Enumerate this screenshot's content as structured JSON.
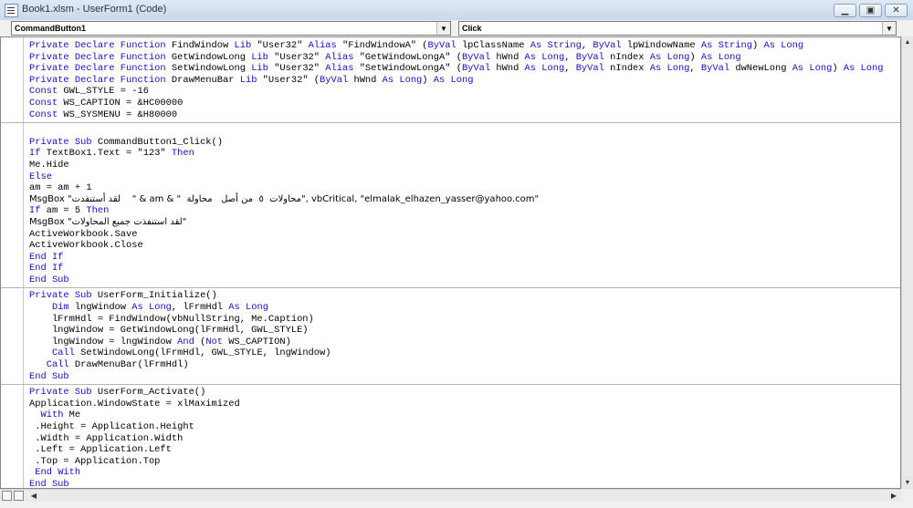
{
  "window": {
    "title": "Book1.xlsm - UserForm1 (Code)",
    "minimize_glyph": "▁",
    "maximize_glyph": "▣",
    "close_glyph": "✕"
  },
  "object_combo": {
    "value": "CommandButton1",
    "arrow": "▼"
  },
  "procedure_combo": {
    "value": "Click",
    "arrow": "▼"
  },
  "scroll": {
    "up": "▲",
    "down": "▼",
    "left": "◀",
    "right": "▶"
  },
  "code": {
    "declarations": [
      [
        {
          "t": "Private Declare Function ",
          "k": true
        },
        {
          "t": "FindWindow "
        },
        {
          "t": "Lib ",
          "k": true
        },
        {
          "t": "\"User32\" "
        },
        {
          "t": "Alias ",
          "k": true
        },
        {
          "t": "\"FindWindowA\" ("
        },
        {
          "t": "ByVal ",
          "k": true
        },
        {
          "t": "lpClassName "
        },
        {
          "t": "As String",
          "k": true
        },
        {
          "t": ", "
        },
        {
          "t": "ByVal ",
          "k": true
        },
        {
          "t": "lpWindowName "
        },
        {
          "t": "As String",
          "k": true
        },
        {
          "t": ") "
        },
        {
          "t": "As Long",
          "k": true
        }
      ],
      [
        {
          "t": "Private Declare Function ",
          "k": true
        },
        {
          "t": "GetWindowLong "
        },
        {
          "t": "Lib ",
          "k": true
        },
        {
          "t": "\"User32\" "
        },
        {
          "t": "Alias ",
          "k": true
        },
        {
          "t": "\"GetWindowLongA\" ("
        },
        {
          "t": "ByVal ",
          "k": true
        },
        {
          "t": "hWnd "
        },
        {
          "t": "As Long",
          "k": true
        },
        {
          "t": ", "
        },
        {
          "t": "ByVal ",
          "k": true
        },
        {
          "t": "nIndex "
        },
        {
          "t": "As Long",
          "k": true
        },
        {
          "t": ") "
        },
        {
          "t": "As Long",
          "k": true
        }
      ],
      [
        {
          "t": "Private Declare Function ",
          "k": true
        },
        {
          "t": "SetWindowLong "
        },
        {
          "t": "Lib ",
          "k": true
        },
        {
          "t": "\"User32\" "
        },
        {
          "t": "Alias ",
          "k": true
        },
        {
          "t": "\"SetWindowLongA\" ("
        },
        {
          "t": "ByVal ",
          "k": true
        },
        {
          "t": "hWnd "
        },
        {
          "t": "As Long",
          "k": true
        },
        {
          "t": ", "
        },
        {
          "t": "ByVal ",
          "k": true
        },
        {
          "t": "nIndex "
        },
        {
          "t": "As Long",
          "k": true
        },
        {
          "t": ", "
        },
        {
          "t": "ByVal ",
          "k": true
        },
        {
          "t": "dwNewLong "
        },
        {
          "t": "As Long",
          "k": true
        },
        {
          "t": ") "
        },
        {
          "t": "As Long",
          "k": true
        }
      ],
      [
        {
          "t": "Private Declare Function ",
          "k": true
        },
        {
          "t": "DrawMenuBar "
        },
        {
          "t": "Lib ",
          "k": true
        },
        {
          "t": "\"User32\" ("
        },
        {
          "t": "ByVal ",
          "k": true
        },
        {
          "t": "hWnd "
        },
        {
          "t": "As Long",
          "k": true
        },
        {
          "t": ") "
        },
        {
          "t": "As Long",
          "k": true
        }
      ],
      [
        {
          "t": "Const ",
          "k": true
        },
        {
          "t": "GWL_STYLE = -16"
        }
      ],
      [
        {
          "t": "Const ",
          "k": true
        },
        {
          "t": "WS_CAPTION = &HC00000"
        }
      ],
      [
        {
          "t": "Const ",
          "k": true
        },
        {
          "t": "WS_SYSMENU = &H80000"
        }
      ]
    ],
    "click_proc": [
      [
        {
          "t": ""
        }
      ],
      [
        {
          "t": "Private Sub ",
          "k": true
        },
        {
          "t": "CommandButton1_Click()"
        }
      ],
      [
        {
          "t": "If ",
          "k": true
        },
        {
          "t": "TextBox1.Text = \"123\" "
        },
        {
          "t": "Then",
          "k": true
        }
      ],
      [
        {
          "t": "Me.Hide"
        }
      ],
      [
        {
          "t": "Else",
          "k": true
        }
      ],
      [
        {
          "t": "am = am + 1"
        }
      ],
      [
        {
          "t": "MsgBox \"لقد أستنفدت    \" & am & \"  محاولات  ٥  من أصل   محاولة\", vbCritical, \"elmalak_elhazen_yasser@yahoo.com\"",
          "a": true
        }
      ],
      [
        {
          "t": "If ",
          "k": true
        },
        {
          "t": "am = 5 "
        },
        {
          "t": "Then",
          "k": true
        }
      ],
      [
        {
          "t": "MsgBox \"لقد استنفذت جميع المحاولات\"",
          "a": true
        }
      ],
      [
        {
          "t": "ActiveWorkbook.Save"
        }
      ],
      [
        {
          "t": "ActiveWorkbook.Close"
        }
      ],
      [
        {
          "t": "End If",
          "k": true
        }
      ],
      [
        {
          "t": "End If",
          "k": true
        }
      ],
      [
        {
          "t": "End Sub",
          "k": true
        }
      ]
    ],
    "initialize_proc": [
      [
        {
          "t": "Private Sub ",
          "k": true
        },
        {
          "t": "UserForm_Initialize()"
        }
      ],
      [
        {
          "t": "    "
        },
        {
          "t": "Dim ",
          "k": true
        },
        {
          "t": "lngWindow "
        },
        {
          "t": "As Long",
          "k": true
        },
        {
          "t": ", lFrmHdl "
        },
        {
          "t": "As Long",
          "k": true
        }
      ],
      [
        {
          "t": "    lFrmHdl = FindWindow(vbNullString, Me.Caption)"
        }
      ],
      [
        {
          "t": "    lngWindow = GetWindowLong(lFrmHdl, GWL_STYLE)"
        }
      ],
      [
        {
          "t": "    lngWindow = lngWindow "
        },
        {
          "t": "And ",
          "k": true
        },
        {
          "t": "("
        },
        {
          "t": "Not ",
          "k": true
        },
        {
          "t": "WS_CAPTION)"
        }
      ],
      [
        {
          "t": "    "
        },
        {
          "t": "Call ",
          "k": true
        },
        {
          "t": "SetWindowLong(lFrmHdl, GWL_STYLE, lngWindow)"
        }
      ],
      [
        {
          "t": "   "
        },
        {
          "t": "Call ",
          "k": true
        },
        {
          "t": "DrawMenuBar(lFrmHdl)"
        }
      ],
      [
        {
          "t": "End Sub",
          "k": true
        }
      ]
    ],
    "activate_proc": [
      [
        {
          "t": "Private Sub ",
          "k": true
        },
        {
          "t": "UserForm_Activate()"
        }
      ],
      [
        {
          "t": "Application.WindowState = xlMaximized"
        }
      ],
      [
        {
          "t": "  "
        },
        {
          "t": "With ",
          "k": true
        },
        {
          "t": "Me"
        }
      ],
      [
        {
          "t": " .Height = Application.Height"
        }
      ],
      [
        {
          "t": " .Width = Application.Width"
        }
      ],
      [
        {
          "t": " .Left = Application.Left"
        }
      ],
      [
        {
          "t": " .Top = Application.Top"
        }
      ],
      [
        {
          "t": " "
        },
        {
          "t": "End With",
          "k": true
        }
      ],
      [
        {
          "t": "End Sub",
          "k": true
        }
      ]
    ]
  }
}
